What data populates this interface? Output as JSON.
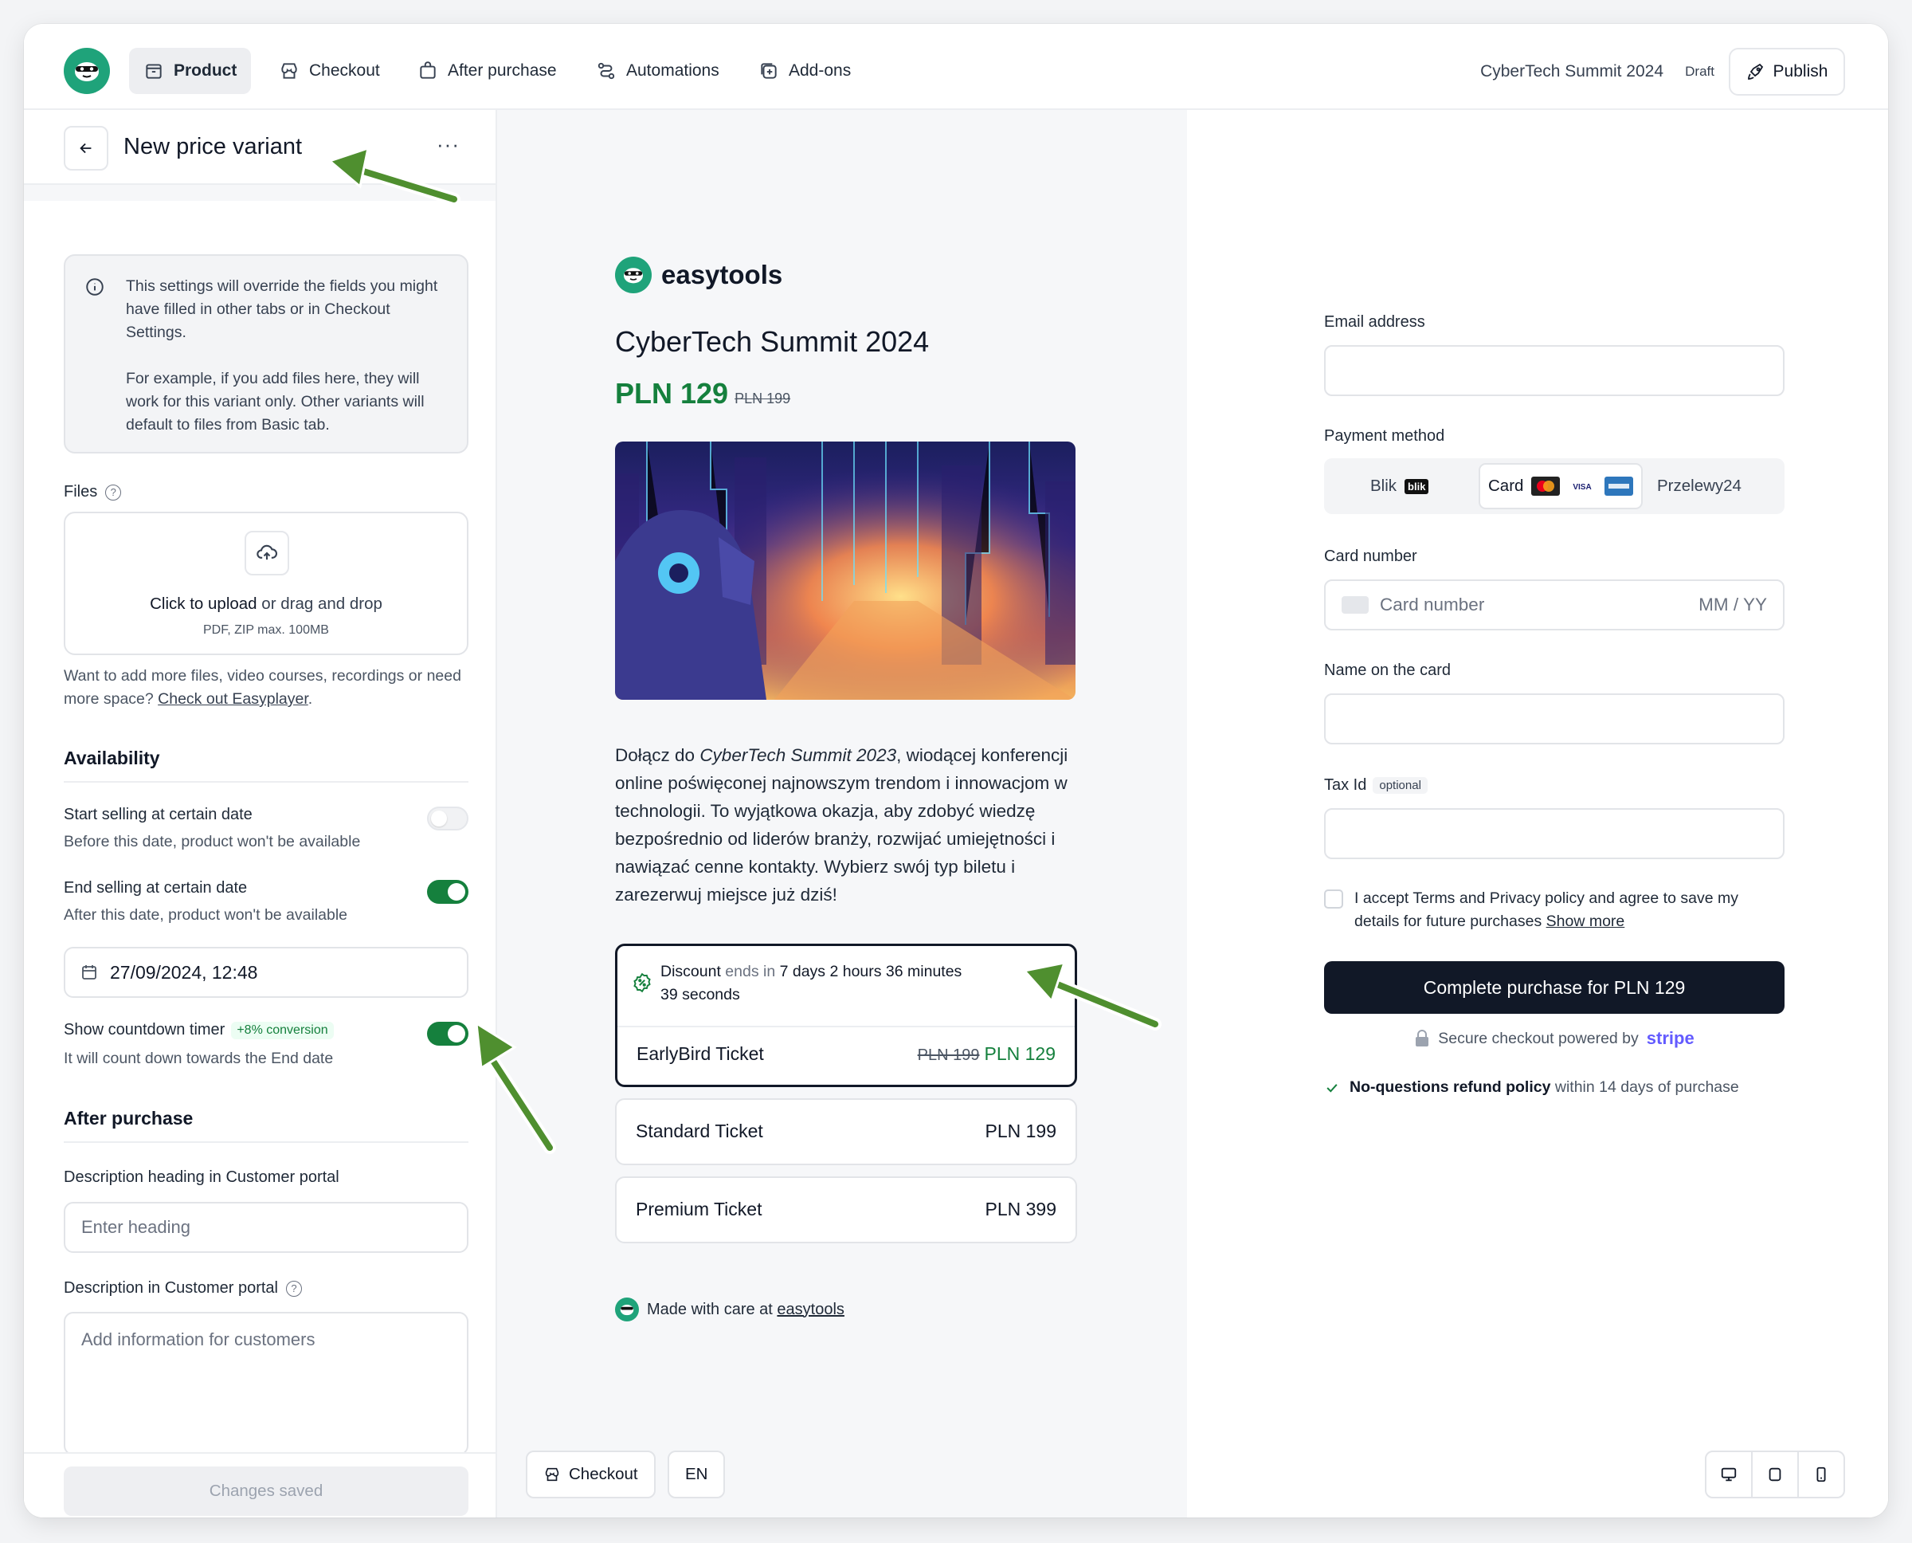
{
  "nav": {
    "items": [
      {
        "label": "Product",
        "icon": "box-icon",
        "active": true
      },
      {
        "label": "Checkout",
        "icon": "store-icon"
      },
      {
        "label": "After purchase",
        "icon": "bag-icon"
      },
      {
        "label": "Automations",
        "icon": "workflow-icon"
      },
      {
        "label": "Add-ons",
        "icon": "plus-square-icon"
      }
    ],
    "product_name": "CyberTech Summit 2024",
    "status": "Draft",
    "publish_label": "Publish"
  },
  "left": {
    "title": "New price variant",
    "more": "···",
    "info_p1": "This settings will override the fields you might have filled in other tabs or in Checkout Settings.",
    "info_p2": "For example, if you add files here, they will work for this variant only. Other variants will default to files from Basic tab.",
    "files_label": "Files",
    "upload_cta": "Click to upload",
    "upload_rest": " or drag and drop",
    "upload_formats": "PDF, ZIP max. 100MB",
    "more_files_text": "Want to add more files, video courses, recordings or need more space? ",
    "more_files_link": "Check out Easyplayer",
    "more_files_end": ".",
    "availability_heading": "Availability",
    "start_title": "Start selling at certain date",
    "start_sub": "Before this date, product won't be available",
    "start_enabled": false,
    "end_title": "End selling at certain date",
    "end_sub": "After this date, product won't be available",
    "end_enabled": true,
    "end_date": "27/09/2024, 12:48",
    "countdown_title": "Show countdown timer",
    "countdown_badge": "+8% conversion",
    "countdown_sub": "It will count down towards the End date",
    "countdown_enabled": true,
    "after_heading": "After purchase",
    "desc_heading_label": "Description heading in Customer portal",
    "desc_heading_placeholder": "Enter heading",
    "desc_label": "Description in Customer portal",
    "desc_placeholder": "Add information for customers",
    "changes_saved": "Changes saved"
  },
  "preview": {
    "brand": "easytools",
    "title": "CyberTech Summit 2024",
    "price": "PLN 129",
    "old_price": "PLN 199",
    "desc_pre": "Dołącz do ",
    "desc_em": "CyberTech Summit 2023",
    "desc_post": ", wiodącej konferencji online poświęconej najnowszym trendom i innowacjom w technologii. To wyjątkowa okazja, aby zdobyć wiedzę bezpośrednio od liderów branży, rozwijać umiejętności i nawiązać cenne kontakty. Wybierz swój typ biletu i zarezerwuj miejsce już dziś!",
    "discount_a": "Discount",
    "discount_b": " ends in ",
    "discount_c": "7 days 2 hours 36 minutes",
    "discount_d": "39 seconds",
    "tickets": [
      {
        "name": "EarlyBird Ticket",
        "old": "PLN 199",
        "price": "PLN 129"
      },
      {
        "name": "Standard Ticket",
        "price": "PLN 199"
      },
      {
        "name": "Premium Ticket",
        "price": "PLN 399"
      }
    ],
    "made_with": "Made with care at ",
    "made_with_link": "easytools",
    "footer_checkout": "Checkout",
    "footer_lang": "EN"
  },
  "checkout": {
    "email_label": "Email address",
    "payment_label": "Payment method",
    "pay_blik": "Blik",
    "pay_blik_logo": "blik",
    "pay_card": "Card",
    "pay_p24": "Przelewy24",
    "card_label": "Card number",
    "card_placeholder": "Card number",
    "expiry_placeholder": "MM / YY",
    "name_label": "Name on the card",
    "tax_label": "Tax Id",
    "tax_optional": "optional",
    "terms_text": "I accept Terms and Privacy policy and agree to save my details for future purchases ",
    "terms_link": "Show more",
    "complete": "Complete purchase for PLN 129",
    "secure_text": "Secure checkout powered by",
    "stripe": "stripe",
    "refund_bold": "No-questions refund policy",
    "refund_rest": " within 14 days of purchase"
  },
  "colors": {
    "accent_green": "#15803d",
    "brand_teal": "#1fa37a",
    "dark": "#111827",
    "stripe": "#635bff"
  }
}
